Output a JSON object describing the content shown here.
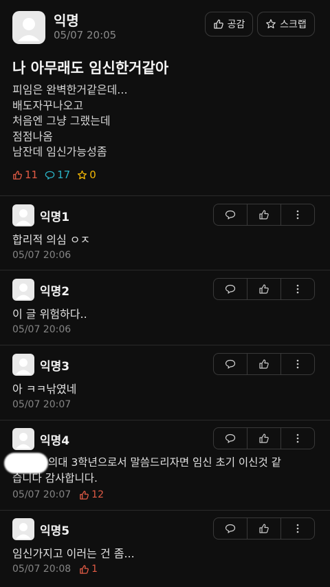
{
  "post": {
    "author": "익명",
    "date": "05/07 20:05",
    "like_button": "공감",
    "scrap_button": "스크랩",
    "title": "나 아무래도 임신한거같아",
    "body_lines": [
      "피임은 완벽한거같은데...",
      "배도자꾸나오고",
      "처음엔 그냥 그랬는데",
      "점점나옴",
      "남잔데 임신가능성좀"
    ],
    "stats": {
      "likes": "11",
      "comments": "17",
      "scraps": "0"
    }
  },
  "comments": [
    {
      "author": "익명1",
      "text": "합리적 의심 ㅇㅈ",
      "date": "05/07 20:06",
      "likes": ""
    },
    {
      "author": "익명2",
      "text": "이 글 위험하다..",
      "date": "05/07 20:06",
      "likes": ""
    },
    {
      "author": "익명3",
      "text": "아 ㅋㅋ낚였네",
      "date": "05/07 20:07",
      "likes": ""
    },
    {
      "author": "익명4",
      "text_line1": "의대 3학년으로서 말씀드리자면 임신 초기 이신것 같",
      "text_line2": "습니다 감사합니다.",
      "date": "05/07 20:07",
      "likes": "12"
    },
    {
      "author": "익명5",
      "text": "임신가지고 이러는 건 좀...",
      "date": "05/07 20:08",
      "likes": "1"
    }
  ],
  "colors": {
    "like_red": "#e25b45",
    "comment_teal": "#2bb5c8",
    "scrap_yellow": "#f2b705"
  },
  "icons": {
    "like": "thumbs-up-icon",
    "comment": "speech-bubble-icon",
    "scrap": "star-icon",
    "more": "more-vertical-icon"
  }
}
